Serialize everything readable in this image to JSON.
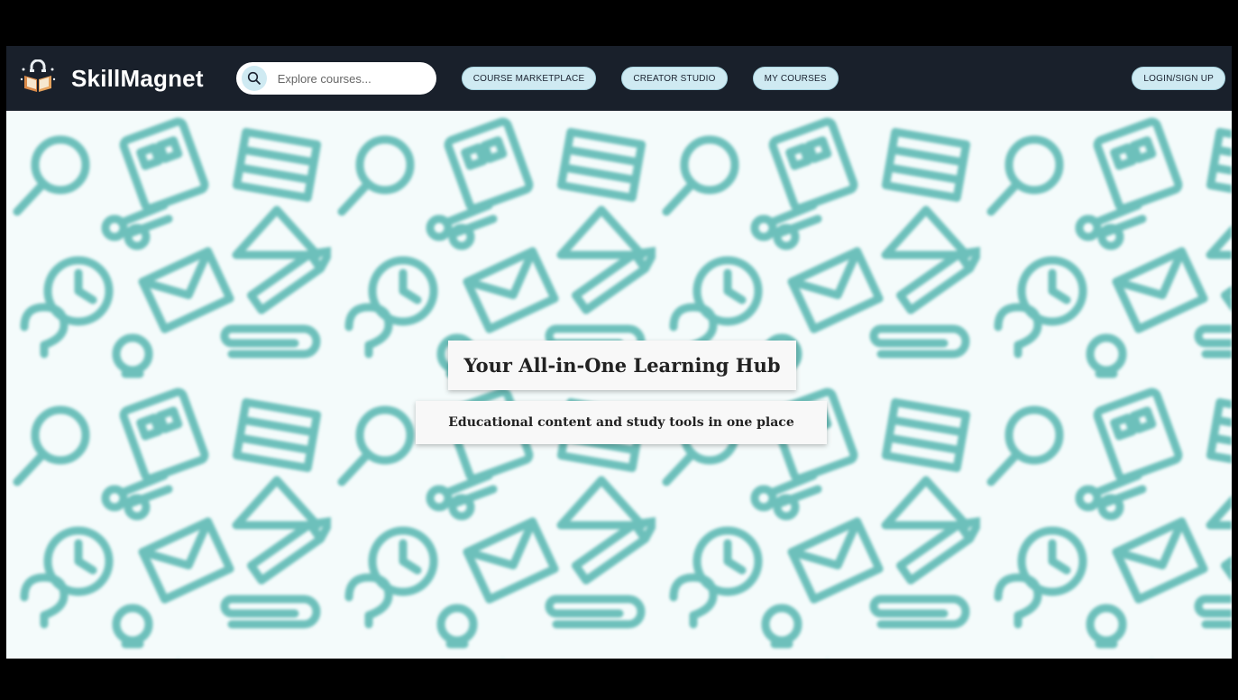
{
  "brand": {
    "name": "SkillMagnet",
    "icon": "book-magnet-icon"
  },
  "search": {
    "placeholder": "Explore courses...",
    "icon": "search-icon"
  },
  "nav": {
    "items": [
      "COURSE MARKETPLACE",
      "CREATOR STUDIO",
      "MY COURSES"
    ],
    "login_label": "LOGIN/SIGN UP"
  },
  "hero": {
    "title": "Your All-in-One Learning Hub",
    "subtitle": "Educational content and study tools in one place",
    "background": "education-doodle-pattern"
  },
  "colors": {
    "navbar": "#19202b",
    "button_bg": "#cfeaf2",
    "pattern": "#4fb3ad",
    "hero_bg": "#f4fbfb"
  }
}
